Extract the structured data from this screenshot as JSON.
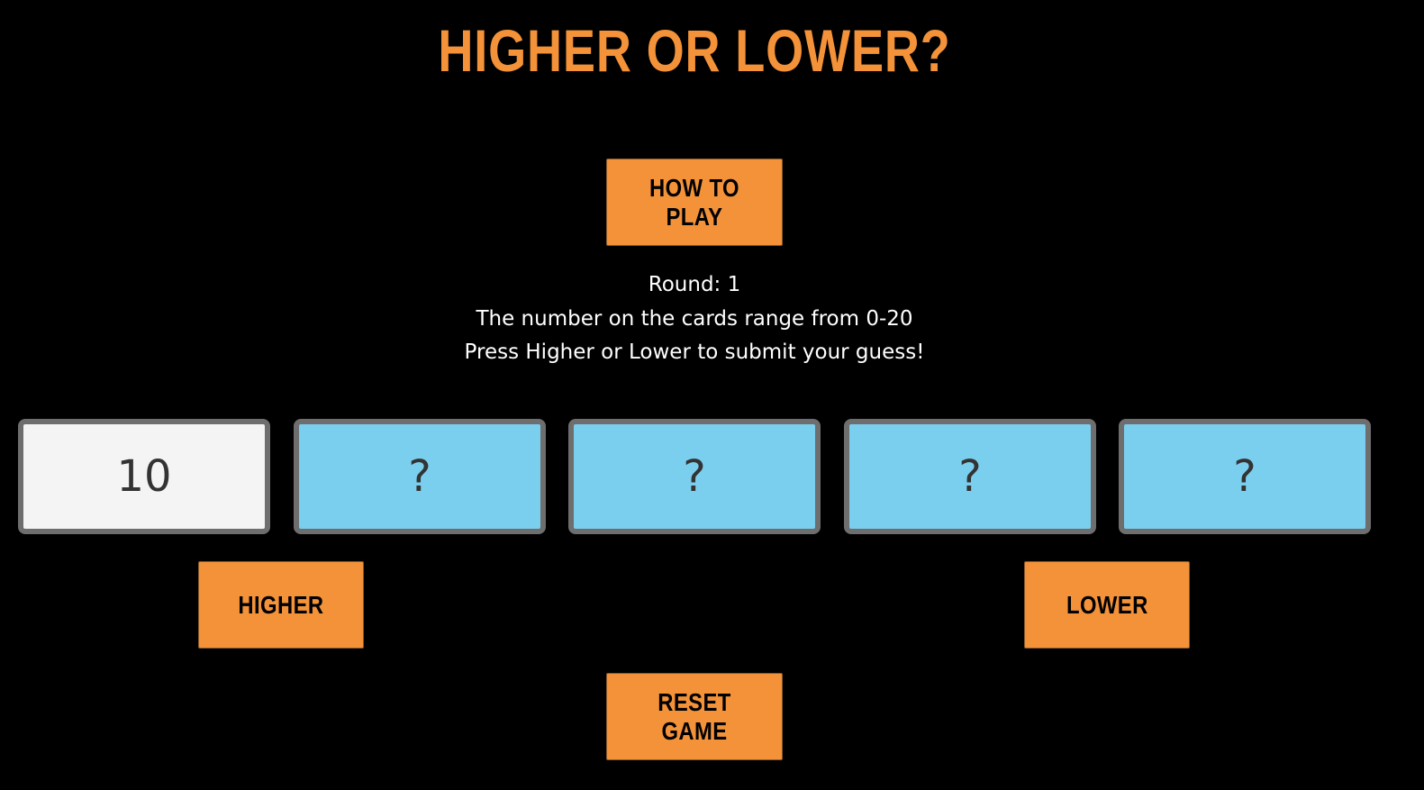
{
  "title": "HIGHER OR LOWER?",
  "buttons": {
    "how_to_play": "HOW TO PLAY",
    "higher": "HIGHER",
    "lower": "LOWER",
    "reset": "RESET GAME"
  },
  "info": {
    "round": "Round: 1",
    "range": "The number on the cards range from 0-20",
    "instruction": "Press Higher or Lower to submit your guess!"
  },
  "cards": [
    {
      "value": "10",
      "state": "revealed"
    },
    {
      "value": "?",
      "state": "hidden"
    },
    {
      "value": "?",
      "state": "hidden"
    },
    {
      "value": "?",
      "state": "hidden"
    },
    {
      "value": "?",
      "state": "hidden"
    }
  ],
  "colors": {
    "accent": "#f39239",
    "background": "#000000",
    "card_revealed": "#f4f4f4",
    "card_hidden": "#7bcfee",
    "card_border": "#6e6e6e"
  }
}
